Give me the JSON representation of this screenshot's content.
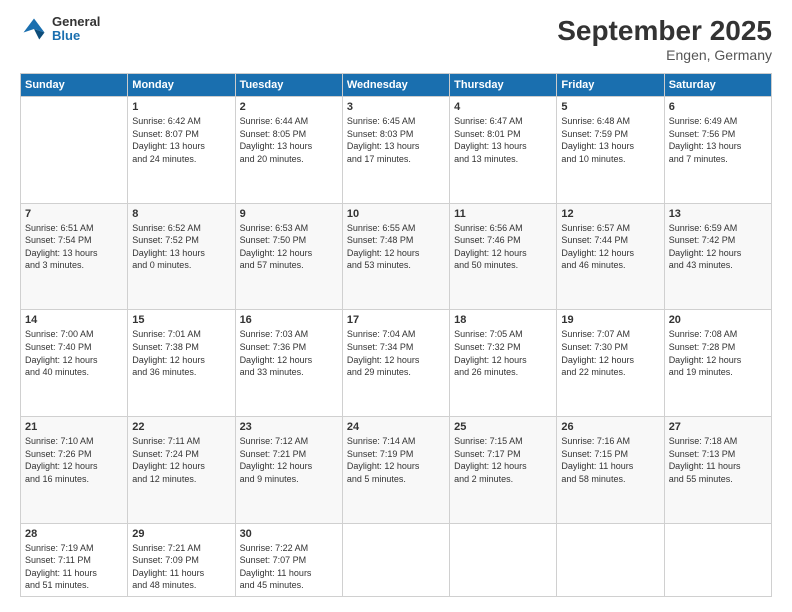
{
  "header": {
    "logo": {
      "general": "General",
      "blue": "Blue"
    },
    "title": "September 2025",
    "subtitle": "Engen, Germany"
  },
  "calendar": {
    "days_of_week": [
      "Sunday",
      "Monday",
      "Tuesday",
      "Wednesday",
      "Thursday",
      "Friday",
      "Saturday"
    ],
    "weeks": [
      [
        {
          "day": "",
          "info": ""
        },
        {
          "day": "1",
          "info": "Sunrise: 6:42 AM\nSunset: 8:07 PM\nDaylight: 13 hours\nand 24 minutes."
        },
        {
          "day": "2",
          "info": "Sunrise: 6:44 AM\nSunset: 8:05 PM\nDaylight: 13 hours\nand 20 minutes."
        },
        {
          "day": "3",
          "info": "Sunrise: 6:45 AM\nSunset: 8:03 PM\nDaylight: 13 hours\nand 17 minutes."
        },
        {
          "day": "4",
          "info": "Sunrise: 6:47 AM\nSunset: 8:01 PM\nDaylight: 13 hours\nand 13 minutes."
        },
        {
          "day": "5",
          "info": "Sunrise: 6:48 AM\nSunset: 7:59 PM\nDaylight: 13 hours\nand 10 minutes."
        },
        {
          "day": "6",
          "info": "Sunrise: 6:49 AM\nSunset: 7:56 PM\nDaylight: 13 hours\nand 7 minutes."
        }
      ],
      [
        {
          "day": "7",
          "info": "Sunrise: 6:51 AM\nSunset: 7:54 PM\nDaylight: 13 hours\nand 3 minutes."
        },
        {
          "day": "8",
          "info": "Sunrise: 6:52 AM\nSunset: 7:52 PM\nDaylight: 13 hours\nand 0 minutes."
        },
        {
          "day": "9",
          "info": "Sunrise: 6:53 AM\nSunset: 7:50 PM\nDaylight: 12 hours\nand 57 minutes."
        },
        {
          "day": "10",
          "info": "Sunrise: 6:55 AM\nSunset: 7:48 PM\nDaylight: 12 hours\nand 53 minutes."
        },
        {
          "day": "11",
          "info": "Sunrise: 6:56 AM\nSunset: 7:46 PM\nDaylight: 12 hours\nand 50 minutes."
        },
        {
          "day": "12",
          "info": "Sunrise: 6:57 AM\nSunset: 7:44 PM\nDaylight: 12 hours\nand 46 minutes."
        },
        {
          "day": "13",
          "info": "Sunrise: 6:59 AM\nSunset: 7:42 PM\nDaylight: 12 hours\nand 43 minutes."
        }
      ],
      [
        {
          "day": "14",
          "info": "Sunrise: 7:00 AM\nSunset: 7:40 PM\nDaylight: 12 hours\nand 40 minutes."
        },
        {
          "day": "15",
          "info": "Sunrise: 7:01 AM\nSunset: 7:38 PM\nDaylight: 12 hours\nand 36 minutes."
        },
        {
          "day": "16",
          "info": "Sunrise: 7:03 AM\nSunset: 7:36 PM\nDaylight: 12 hours\nand 33 minutes."
        },
        {
          "day": "17",
          "info": "Sunrise: 7:04 AM\nSunset: 7:34 PM\nDaylight: 12 hours\nand 29 minutes."
        },
        {
          "day": "18",
          "info": "Sunrise: 7:05 AM\nSunset: 7:32 PM\nDaylight: 12 hours\nand 26 minutes."
        },
        {
          "day": "19",
          "info": "Sunrise: 7:07 AM\nSunset: 7:30 PM\nDaylight: 12 hours\nand 22 minutes."
        },
        {
          "day": "20",
          "info": "Sunrise: 7:08 AM\nSunset: 7:28 PM\nDaylight: 12 hours\nand 19 minutes."
        }
      ],
      [
        {
          "day": "21",
          "info": "Sunrise: 7:10 AM\nSunset: 7:26 PM\nDaylight: 12 hours\nand 16 minutes."
        },
        {
          "day": "22",
          "info": "Sunrise: 7:11 AM\nSunset: 7:24 PM\nDaylight: 12 hours\nand 12 minutes."
        },
        {
          "day": "23",
          "info": "Sunrise: 7:12 AM\nSunset: 7:21 PM\nDaylight: 12 hours\nand 9 minutes."
        },
        {
          "day": "24",
          "info": "Sunrise: 7:14 AM\nSunset: 7:19 PM\nDaylight: 12 hours\nand 5 minutes."
        },
        {
          "day": "25",
          "info": "Sunrise: 7:15 AM\nSunset: 7:17 PM\nDaylight: 12 hours\nand 2 minutes."
        },
        {
          "day": "26",
          "info": "Sunrise: 7:16 AM\nSunset: 7:15 PM\nDaylight: 11 hours\nand 58 minutes."
        },
        {
          "day": "27",
          "info": "Sunrise: 7:18 AM\nSunset: 7:13 PM\nDaylight: 11 hours\nand 55 minutes."
        }
      ],
      [
        {
          "day": "28",
          "info": "Sunrise: 7:19 AM\nSunset: 7:11 PM\nDaylight: 11 hours\nand 51 minutes."
        },
        {
          "day": "29",
          "info": "Sunrise: 7:21 AM\nSunset: 7:09 PM\nDaylight: 11 hours\nand 48 minutes."
        },
        {
          "day": "30",
          "info": "Sunrise: 7:22 AM\nSunset: 7:07 PM\nDaylight: 11 hours\nand 45 minutes."
        },
        {
          "day": "",
          "info": ""
        },
        {
          "day": "",
          "info": ""
        },
        {
          "day": "",
          "info": ""
        },
        {
          "day": "",
          "info": ""
        }
      ]
    ]
  }
}
